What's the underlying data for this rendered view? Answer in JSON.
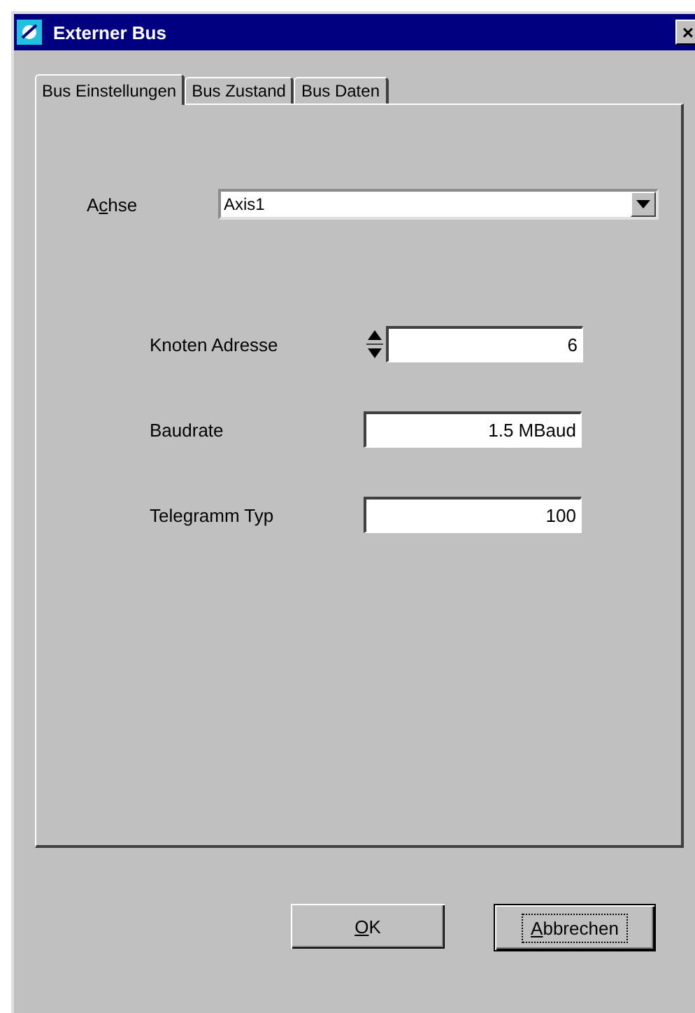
{
  "window": {
    "title": "Externer Bus",
    "close": "×"
  },
  "tabs": [
    {
      "label": "Bus Einstellungen",
      "selected": true
    },
    {
      "label": "Bus Zustand",
      "selected": false
    },
    {
      "label": "Bus Daten",
      "selected": false
    }
  ],
  "axis": {
    "label_parts": [
      "A",
      "c",
      "hse"
    ],
    "value": "Axis1"
  },
  "fields": [
    {
      "kind": "spin",
      "label": "Knoten Adresse",
      "value": "6"
    },
    {
      "kind": "text",
      "label": "Baudrate",
      "value": "1.5 MBaud"
    },
    {
      "kind": "text",
      "label": "Telegramm Typ",
      "value": "100"
    }
  ],
  "buttons": [
    {
      "label_parts": [
        "O",
        "K"
      ],
      "default": false
    },
    {
      "label_parts": [
        "A",
        "bbrechen"
      ],
      "default": true
    }
  ]
}
